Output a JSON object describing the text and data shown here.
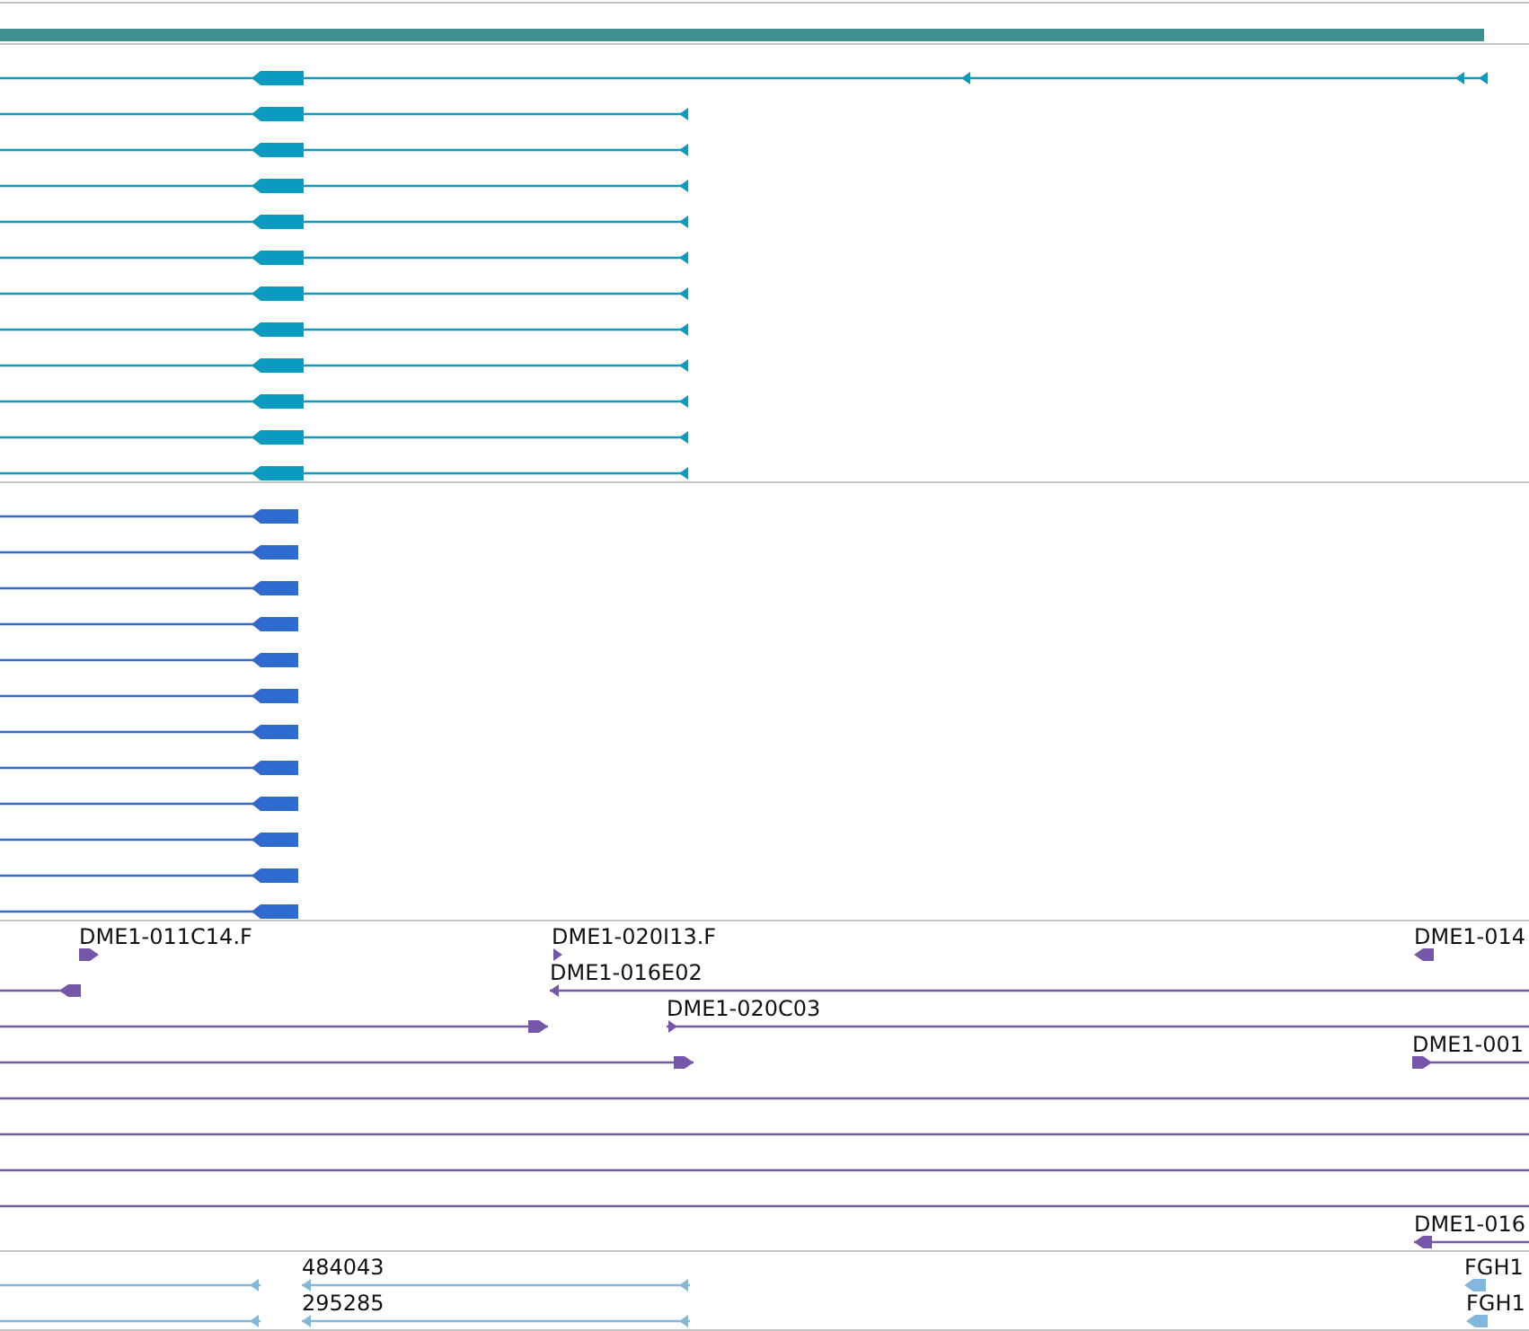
{
  "tracks": [
    {
      "kind": "span",
      "color": "#3f8f8f"
    },
    {
      "kind": "transcripts",
      "color": "#0a9cc0",
      "rows": [
        {
          "kind": "features",
          "features": [
            {
              "reverse": true
            }
          ]
        },
        {
          "kind": "features",
          "features": [
            {
              "reverse": true
            }
          ]
        },
        {
          "kind": "features",
          "features": [
            {
              "reverse": true
            }
          ]
        },
        {
          "kind": "features",
          "features": [
            {
              "reverse": true
            }
          ]
        },
        {
          "kind": "features",
          "features": [
            {
              "reverse": true
            }
          ]
        },
        {
          "kind": "features",
          "features": [
            {
              "reverse": true
            }
          ]
        },
        {
          "kind": "features",
          "features": [
            {
              "reverse": true
            }
          ]
        },
        {
          "kind": "features",
          "features": [
            {
              "reverse": true
            }
          ]
        },
        {
          "kind": "features",
          "features": [
            {
              "reverse": true
            }
          ]
        },
        {
          "kind": "features",
          "features": [
            {
              "reverse": true
            }
          ]
        },
        {
          "kind": "features",
          "features": [
            {
              "reverse": true
            }
          ]
        },
        {
          "kind": "features",
          "features": [
            {
              "reverse": true
            }
          ]
        }
      ]
    },
    {
      "kind": "transcripts",
      "color": "#2f6bcf",
      "rows": [
        {
          "kind": "features",
          "features": [
            {
              "reverse": true
            }
          ]
        },
        {
          "kind": "features",
          "features": [
            {
              "reverse": true
            }
          ]
        },
        {
          "kind": "features",
          "features": [
            {
              "reverse": true
            }
          ]
        },
        {
          "kind": "features",
          "features": [
            {
              "reverse": true
            }
          ]
        },
        {
          "kind": "features",
          "features": [
            {
              "reverse": true
            }
          ]
        },
        {
          "kind": "features",
          "features": [
            {
              "reverse": true
            }
          ]
        },
        {
          "kind": "features",
          "features": [
            {
              "reverse": true
            }
          ]
        },
        {
          "kind": "features",
          "features": [
            {
              "reverse": true
            }
          ]
        },
        {
          "kind": "features",
          "features": [
            {
              "reverse": true
            }
          ]
        },
        {
          "kind": "features",
          "features": [
            {
              "reverse": true
            }
          ]
        },
        {
          "kind": "features",
          "features": [
            {
              "reverse": true
            }
          ]
        },
        {
          "kind": "features",
          "features": [
            {
              "reverse": true
            }
          ]
        }
      ]
    },
    {
      "kind": "clones",
      "color": "#7656a8",
      "rows": [
        {
          "kind": "features",
          "features": [
            {
              "label": "DME1-011C14.F",
              "reverse": false
            },
            {
              "label": "DME1-020I13.F",
              "reverse": false
            },
            {
              "label": "DME1-014",
              "reverse": true
            }
          ]
        },
        {
          "kind": "features",
          "features": [
            {
              "reverse": true
            },
            {
              "label": "DME1-016E02",
              "reverse": true
            }
          ]
        },
        {
          "kind": "features",
          "features": [
            {
              "reverse": false
            },
            {
              "label": "DME1-020C03",
              "reverse": false
            }
          ]
        },
        {
          "kind": "features",
          "features": [
            {
              "reverse": false
            },
            {
              "label": "DME1-001",
              "reverse": false
            }
          ]
        },
        {
          "kind": "line"
        },
        {
          "kind": "line"
        },
        {
          "kind": "line"
        },
        {
          "kind": "line"
        },
        {
          "kind": "features",
          "features": [
            {
              "label": "DME1-016",
              "reverse": true
            }
          ]
        }
      ]
    },
    {
      "kind": "clones",
      "color": "#82b8e0",
      "rows": [
        {
          "kind": "features",
          "features": [
            {
              "reverse": true
            },
            {
              "label": "484043",
              "reverse": true
            },
            {
              "label": "FGH1",
              "reverse": true
            }
          ]
        },
        {
          "kind": "features",
          "features": [
            {
              "reverse": true
            },
            {
              "label": "295285",
              "reverse": true
            },
            {
              "label": "FGH1",
              "reverse": true
            }
          ]
        }
      ]
    }
  ]
}
